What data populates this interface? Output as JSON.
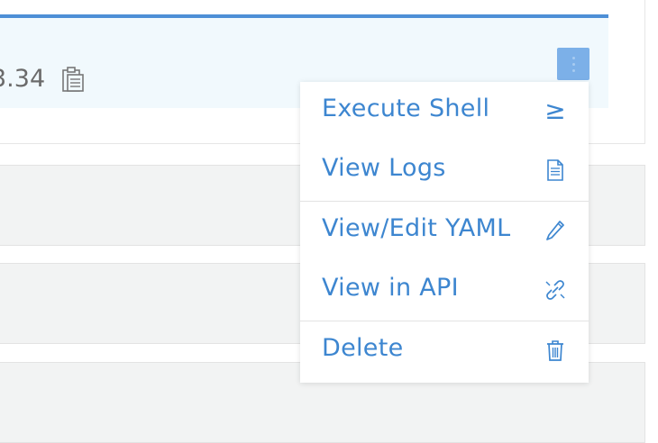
{
  "row": {
    "ip_partial": "3.34",
    "copy_icon": "clipboard-icon"
  },
  "actions_button": {
    "icon": "kebab-vertical-icon"
  },
  "menu": {
    "items": [
      {
        "label": "Execute Shell",
        "icon": "terminal-icon",
        "glyph": "≥"
      },
      {
        "label": "View Logs",
        "icon": "file-icon"
      },
      {
        "label": "View/Edit YAML",
        "icon": "pencil-icon"
      },
      {
        "label": "View in API",
        "icon": "external-link-icon"
      },
      {
        "label": "Delete",
        "icon": "trash-icon"
      }
    ]
  },
  "colors": {
    "accent": "#3d86d0",
    "top_border": "#4d8fd6",
    "panel_bg": "#f1f9fd",
    "kebab_bg": "#7cb0e8"
  }
}
